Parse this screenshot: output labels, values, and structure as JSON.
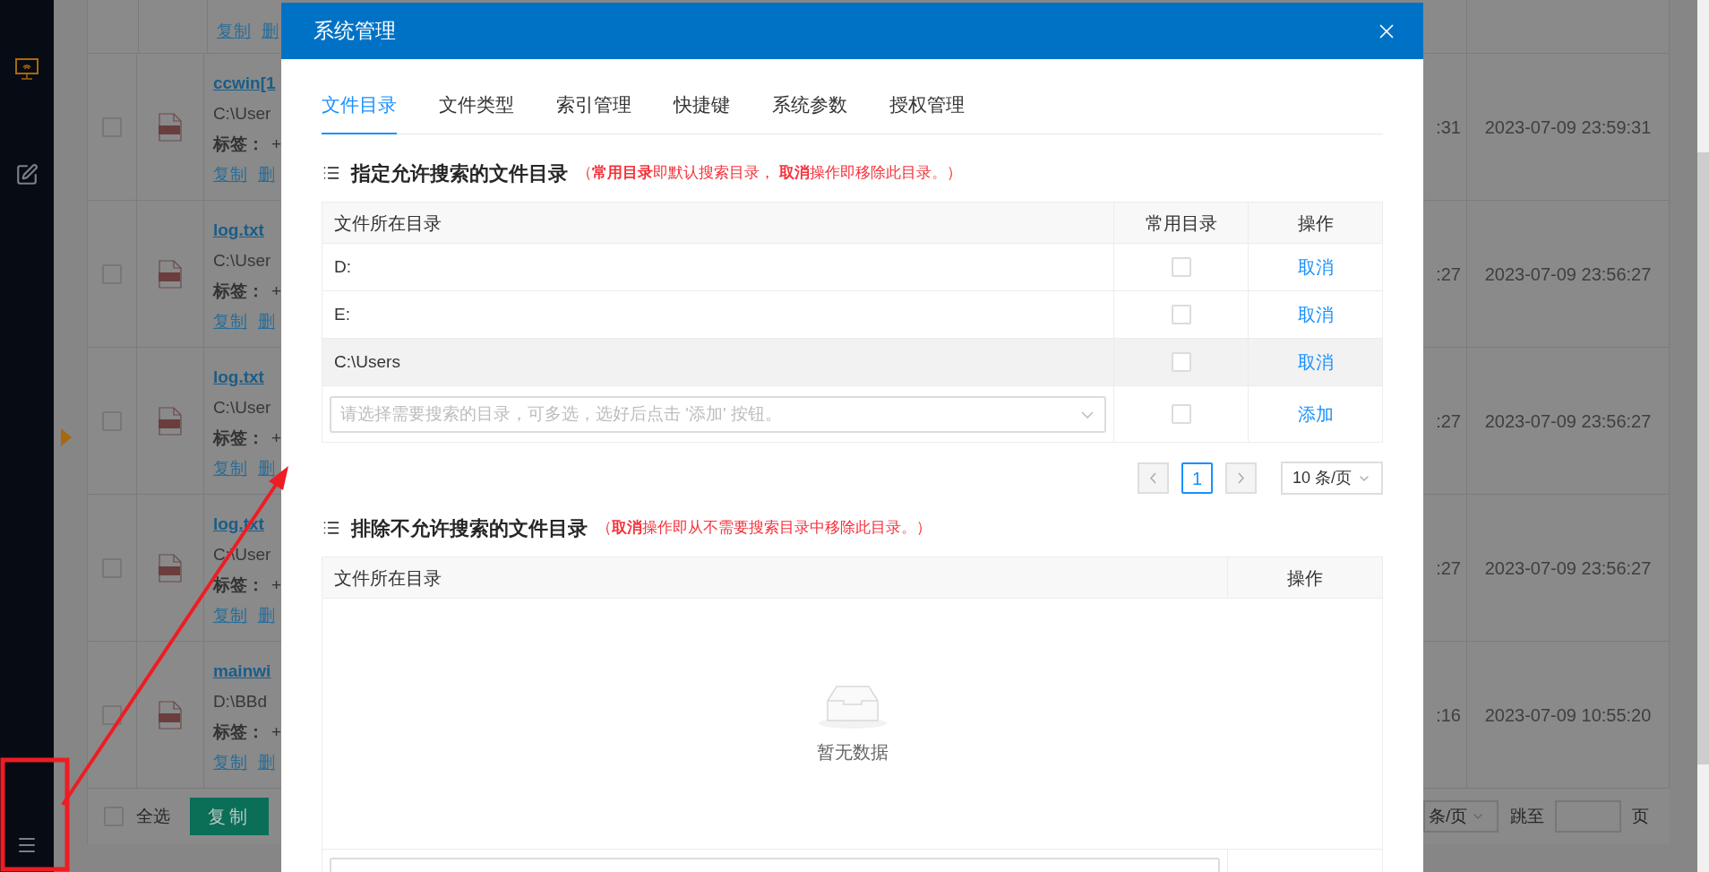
{
  "sidebar": {
    "items": [
      {
        "kind": "monitor",
        "selected": true
      },
      {
        "kind": "edit",
        "selected": false
      }
    ]
  },
  "file_list": {
    "top_links": [
      "复制",
      "删"
    ],
    "rows": [
      {
        "name": "ccwin[1",
        "path": "C:\\User",
        "tag_label": "标签：",
        "tag_add": "+",
        "links": [
          "复制",
          "删"
        ],
        "checked": false,
        "time_1": ":31",
        "time_2": "2023-07-09 23:59:31"
      },
      {
        "name": "log.txt",
        "path": "C:\\User",
        "tag_label": "标签：",
        "tag_add": "+",
        "links": [
          "复制",
          "删"
        ],
        "checked": false,
        "time_1": ":27",
        "time_2": "2023-07-09 23:56:27"
      },
      {
        "name": "log.txt",
        "path": "C:\\User",
        "tag_label": "标签：",
        "tag_add": "+",
        "links": [
          "复制",
          "删"
        ],
        "checked": false,
        "time_1": ":27",
        "time_2": "2023-07-09 23:56:27"
      },
      {
        "name": "log.txt",
        "path": "C:\\User",
        "tag_label": "标签：",
        "tag_add": "+",
        "links": [
          "复制",
          "删"
        ],
        "checked": false,
        "time_1": ":27",
        "time_2": "2023-07-09 23:56:27"
      },
      {
        "name": "mainwi",
        "path": "D:\\BBd",
        "tag_label": "标签：",
        "tag_add": "+",
        "links": [
          "复制",
          "删"
        ],
        "checked": false,
        "time_1": ":16",
        "time_2": "2023-07-09 10:55:20"
      }
    ],
    "footer": {
      "select_all": "全选",
      "select_all_checked": false,
      "copy_button": "复制",
      "page_size": "条/页",
      "jump_label": "跳至",
      "page_unit": "页"
    }
  },
  "dialog": {
    "title": "系统管理",
    "tabs": [
      {
        "label": "文件目录",
        "selected": true
      },
      {
        "label": "文件类型",
        "selected": false
      },
      {
        "label": "索引管理",
        "selected": false
      },
      {
        "label": "快捷键",
        "selected": false
      },
      {
        "label": "系统参数",
        "selected": false
      },
      {
        "label": "授权管理",
        "selected": false
      }
    ],
    "allowed": {
      "title": "指定允许搜索的文件目录",
      "note": "（**常用目录**即默认搜索目录， **取消**操作即移除此目录。）",
      "columns": [
        "文件所在目录",
        "常用目录",
        "操作"
      ],
      "rows": [
        {
          "path": "D:",
          "common": false,
          "action": "取消",
          "hovered": false
        },
        {
          "path": "E:",
          "common": false,
          "action": "取消",
          "hovered": false
        },
        {
          "path": "C:\\Users",
          "common": false,
          "action": "取消",
          "hovered": true
        }
      ],
      "add_row": {
        "placeholder": "请选择需要搜索的目录，可多选，选好后点击 '添加' 按钮。",
        "common": false,
        "action": "添加"
      },
      "pagination": {
        "pages": [
          {
            "label": "1",
            "selected": true
          }
        ],
        "page_size": "10 条/页"
      }
    },
    "excluded": {
      "title": "排除不允许搜索的文件目录",
      "note": "（**取消**操作即从不需要搜索目录中移除此目录。）",
      "columns": [
        "文件所在目录",
        "操作"
      ],
      "empty_text": "暂无数据"
    }
  }
}
